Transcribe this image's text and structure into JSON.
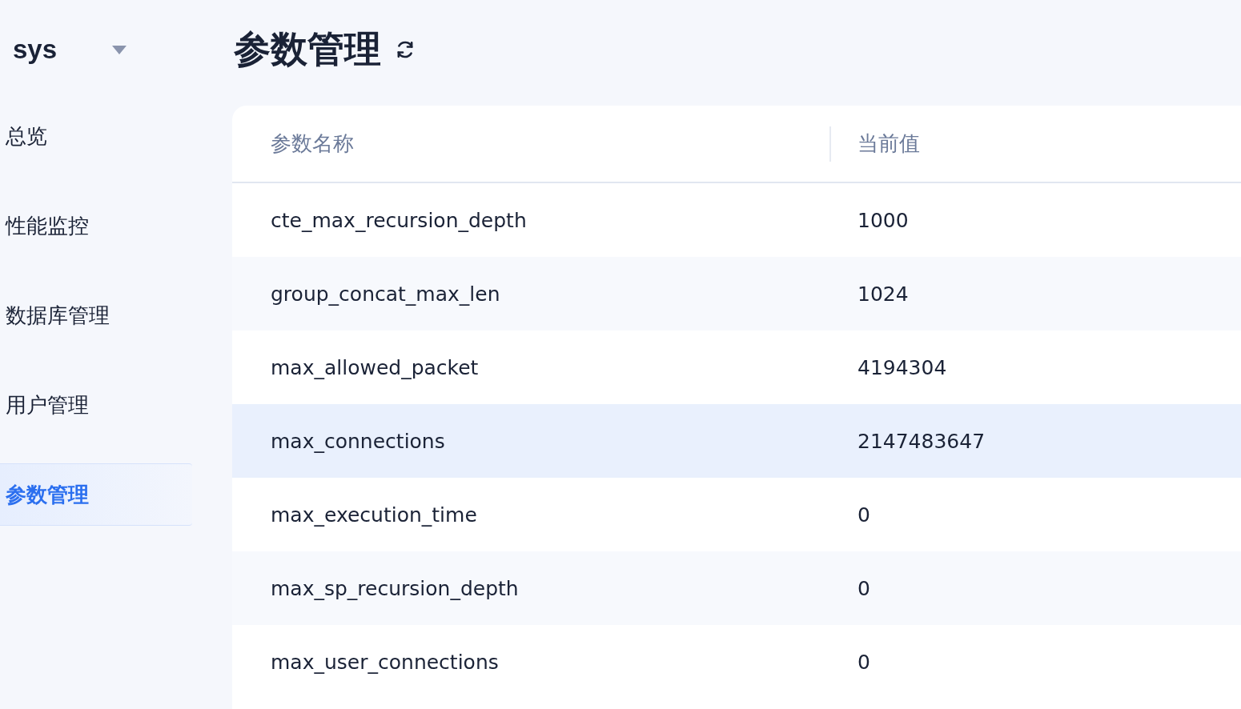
{
  "sidebar": {
    "database": "sys",
    "items": [
      {
        "label": "总览",
        "selected": false
      },
      {
        "label": "性能监控",
        "selected": false
      },
      {
        "label": "数据库管理",
        "selected": false
      },
      {
        "label": "用户管理",
        "selected": false
      },
      {
        "label": "参数管理",
        "selected": true
      }
    ]
  },
  "page": {
    "title": "参数管理"
  },
  "table": {
    "columns": [
      "参数名称",
      "当前值"
    ],
    "rows": [
      {
        "name": "cte_max_recursion_depth",
        "value": "1000",
        "selected": false
      },
      {
        "name": "group_concat_max_len",
        "value": "1024",
        "selected": false
      },
      {
        "name": "max_allowed_packet",
        "value": "4194304",
        "selected": false
      },
      {
        "name": "max_connections",
        "value": "2147483647",
        "selected": true
      },
      {
        "name": "max_execution_time",
        "value": "0",
        "selected": false
      },
      {
        "name": "max_sp_recursion_depth",
        "value": "0",
        "selected": false
      },
      {
        "name": "max_user_connections",
        "value": "0",
        "selected": false
      }
    ]
  }
}
